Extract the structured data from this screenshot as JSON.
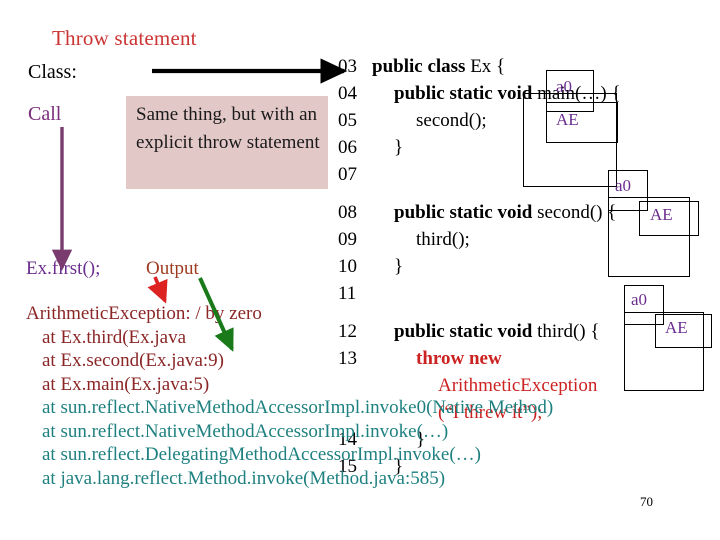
{
  "slide": {
    "title": "Throw statement",
    "page_number": "70",
    "colors": {
      "title_red": "#cc3333",
      "call_purple": "#7a2d7a",
      "output_brown": "#9e3b1f",
      "callout_pink": "#e3c8c8",
      "code_red": "#cc2222",
      "trace_red": "#8b2626",
      "trace_teal": "#1f8080",
      "object_purple": "#6b2d8f",
      "green_arrow": "#1a7a1a",
      "red_arrow": "#dd2222",
      "purple_arrow": "#7a3b6e",
      "black_arrow": "#000000"
    }
  },
  "labels": {
    "class": "Class:",
    "call": "Call",
    "ex_first": "Ex.first();",
    "output": "Output"
  },
  "callout": {
    "text": "Same thing, but with an explicit throw statement"
  },
  "code": {
    "lines": [
      {
        "num": "03",
        "indent": 0,
        "parts": [
          {
            "t": "public class ",
            "style": "bold"
          },
          {
            "t": "Ex {",
            "style": "plain"
          }
        ]
      },
      {
        "num": "04",
        "indent": 1,
        "parts": [
          {
            "t": "public static void ",
            "style": "bold"
          },
          {
            "t": "main(…) {",
            "style": "plain"
          }
        ]
      },
      {
        "num": "05",
        "indent": 2,
        "parts": [
          {
            "t": "second();",
            "style": "plain"
          }
        ]
      },
      {
        "num": "06",
        "indent": 1,
        "parts": [
          {
            "t": "}",
            "style": "plain"
          }
        ]
      },
      {
        "num": "07",
        "indent": 0,
        "parts": []
      },
      {
        "num": "08",
        "indent": 1,
        "parts": [
          {
            "t": "public static void ",
            "style": "bold"
          },
          {
            "t": "second() {",
            "style": "plain"
          }
        ]
      },
      {
        "num": "09",
        "indent": 2,
        "parts": [
          {
            "t": "third();",
            "style": "plain"
          }
        ]
      },
      {
        "num": "10",
        "indent": 1,
        "parts": [
          {
            "t": "}",
            "style": "plain"
          }
        ]
      },
      {
        "num": "11",
        "indent": 0,
        "parts": []
      },
      {
        "num": "12",
        "indent": 1,
        "parts": [
          {
            "t": "public static void ",
            "style": "bold"
          },
          {
            "t": "third() {",
            "style": "plain"
          }
        ]
      },
      {
        "num": "13",
        "indent": 2,
        "parts": [
          {
            "t": "throw new",
            "style": "redbold"
          }
        ]
      },
      {
        "num": "",
        "indent": 3,
        "parts": [
          {
            "t": "ArithmeticException",
            "style": "red"
          }
        ]
      },
      {
        "num": "",
        "indent": 3,
        "parts": [
          {
            "t": "(“I threw it”);",
            "style": "red"
          }
        ]
      },
      {
        "num": "14",
        "indent": 2,
        "parts": [
          {
            "t": "}",
            "style": "plain"
          }
        ]
      },
      {
        "num": "15",
        "indent": 1,
        "parts": [
          {
            "t": "}",
            "style": "plain"
          }
        ]
      }
    ]
  },
  "object_groups": [
    {
      "id": "group-main",
      "a0": "a0",
      "ae": "AE"
    },
    {
      "id": "group-second",
      "a0": "a0",
      "ae": "AE"
    },
    {
      "id": "group-third",
      "a0": "a0",
      "ae": "AE"
    }
  ],
  "trace": {
    "lines": [
      {
        "text": "ArithmeticException: / by zero",
        "color": "red",
        "indent": false
      },
      {
        "text": "at Ex.third(Ex.java",
        "color": "red",
        "indent": true
      },
      {
        "text": "at Ex.second(Ex.java:9)",
        "color": "red",
        "indent": true
      },
      {
        "text": "at Ex.main(Ex.java:5)",
        "color": "red",
        "indent": true
      },
      {
        "text": "at sun.reflect.NativeMethodAccessorImpl.invoke0(Native Method)",
        "color": "teal",
        "indent": true
      },
      {
        "text": "at sun.reflect.NativeMethodAccessorImpl.invoke(…)",
        "color": "teal",
        "indent": true
      },
      {
        "text": "at sun.reflect.DelegatingMethodAccessorImpl.invoke(…)",
        "color": "teal",
        "indent": true
      },
      {
        "text": "at java.lang.reflect.Method.invoke(Method.java:585)",
        "color": "teal",
        "indent": true
      }
    ]
  }
}
